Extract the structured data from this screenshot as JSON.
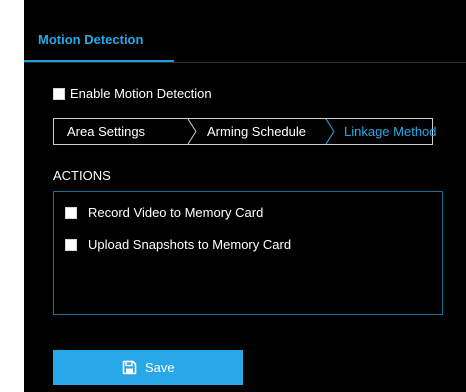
{
  "tabs": {
    "active_label": "Motion Detection"
  },
  "enable": {
    "label": "Enable Motion Detection",
    "checked": false
  },
  "steps": [
    {
      "label": "Area Settings",
      "active": false
    },
    {
      "label": "Arming Schedule",
      "active": false
    },
    {
      "label": "Linkage Method",
      "active": true
    }
  ],
  "actions": {
    "title": "ACTIONS",
    "items": [
      {
        "label": "Record Video to Memory Card",
        "checked": false
      },
      {
        "label": "Upload Snapshots to Memory Card",
        "checked": false
      }
    ]
  },
  "save": {
    "label": "Save",
    "icon": "floppy-disk-icon"
  },
  "colors": {
    "accent": "#28a8e8",
    "background": "#000000",
    "box_border": "#1d6f99"
  }
}
